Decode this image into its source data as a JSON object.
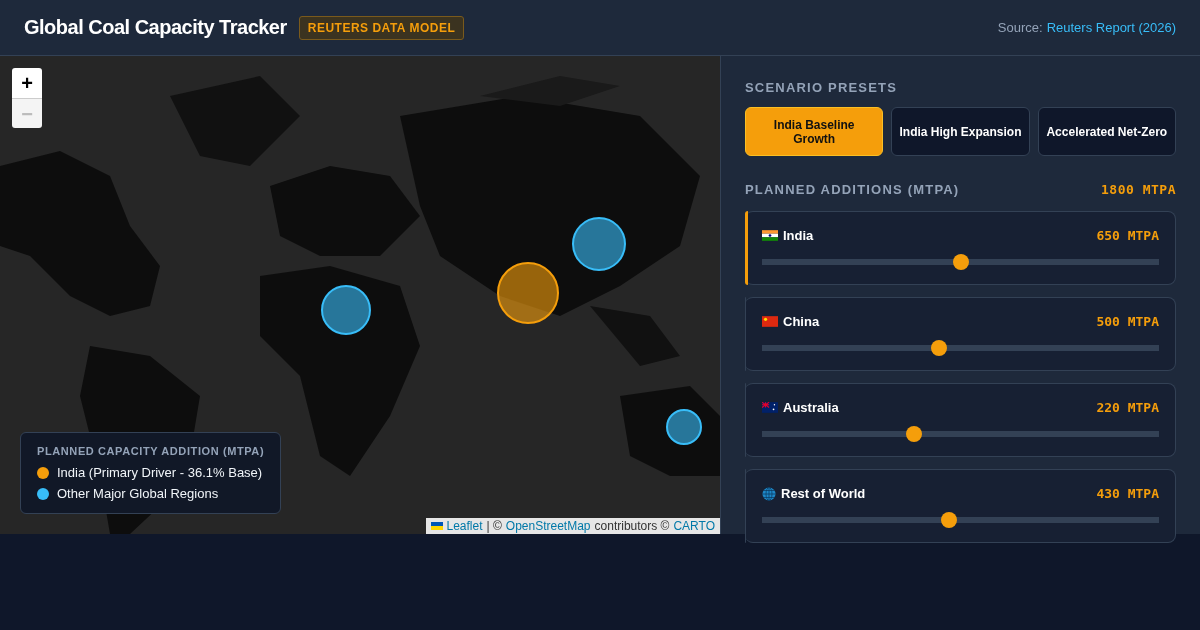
{
  "header": {
    "title": "Global Coal Capacity Tracker",
    "badge": "REUTERS DATA MODEL",
    "source_label": "Source:",
    "source_link": "Reuters Report (2026)"
  },
  "map": {
    "kind": "picture",
    "zoom_in": "+",
    "zoom_out": "−",
    "markers": [
      {
        "color": "#38bdf8"
      },
      {
        "color": "#f59e0b"
      },
      {
        "color": "#38bdf8"
      },
      {
        "color": "#38bdf8"
      }
    ],
    "legend": {
      "title": "PLANNED CAPACITY ADDITION (MTPA)",
      "items": [
        {
          "label": "India (Primary Driver - 36.1% Base)",
          "color": "#f59e0b"
        },
        {
          "label": "Other Major Global Regions",
          "color": "#38bdf8"
        }
      ]
    },
    "attribution": {
      "leaflet": "Leaflet",
      "sep": "| ©",
      "osm": "OpenStreetMap",
      "contributors": "contributors ©",
      "carto": "CARTO"
    }
  },
  "presets": {
    "title": "SCENARIO PRESETS",
    "buttons": [
      {
        "label": "India Baseline Growth",
        "selected": true
      },
      {
        "label": "India High Expansion",
        "selected": false
      },
      {
        "label": "Accelerated Net-Zero",
        "selected": false
      }
    ]
  },
  "additions": {
    "title": "PLANNED ADDITIONS (MTPA)",
    "total": "1800 MTPA",
    "regions": [
      {
        "name": "India",
        "kind": "india-flag",
        "reading": "650 MTPA",
        "level": 0.5,
        "highlighted": true
      },
      {
        "name": "China",
        "kind": "china-flag",
        "reading": "500 MTPA",
        "level": 0.446,
        "highlighted": false
      },
      {
        "name": "Australia",
        "kind": "australia-flag",
        "reading": "220 MTPA",
        "level": 0.383,
        "highlighted": false
      },
      {
        "name": "Rest of World",
        "kind": "globe",
        "reading": "430 MTPA",
        "level": 0.47,
        "highlighted": false
      }
    ]
  }
}
